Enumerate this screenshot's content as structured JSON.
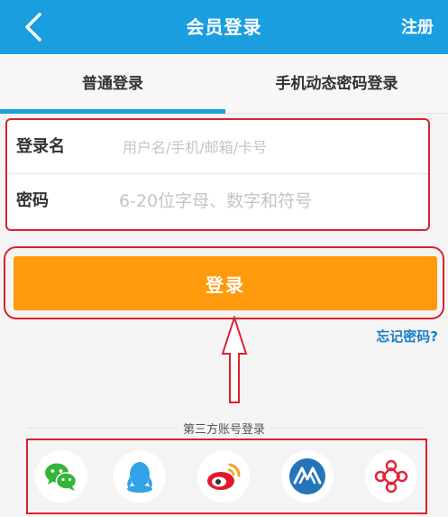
{
  "header": {
    "title": "会员登录",
    "register_label": "注册",
    "back_icon": "chevron-left-icon"
  },
  "tabs": [
    {
      "label": "普通登录",
      "active": true
    },
    {
      "label": "手机动态密码登录",
      "active": false
    }
  ],
  "form": {
    "username": {
      "label": "登录名",
      "placeholder": "用户名/手机/邮箱/卡号",
      "value": ""
    },
    "password": {
      "label": "密码",
      "placeholder": "6-20位字母、数字和符号",
      "value": ""
    }
  },
  "login_button": {
    "label": "登录"
  },
  "forgot_password": {
    "label": "忘记密码?"
  },
  "third_party": {
    "label": "第三方账号登录",
    "icons": [
      "wechat-icon",
      "qq-icon",
      "weibo-icon",
      "alipay-icon",
      "unicom-icon"
    ]
  },
  "colors": {
    "primary": "#1a9ee0",
    "login_button": "#ff9a0c",
    "annotation_red": "#d9232d",
    "link": "#1a7fc8"
  }
}
